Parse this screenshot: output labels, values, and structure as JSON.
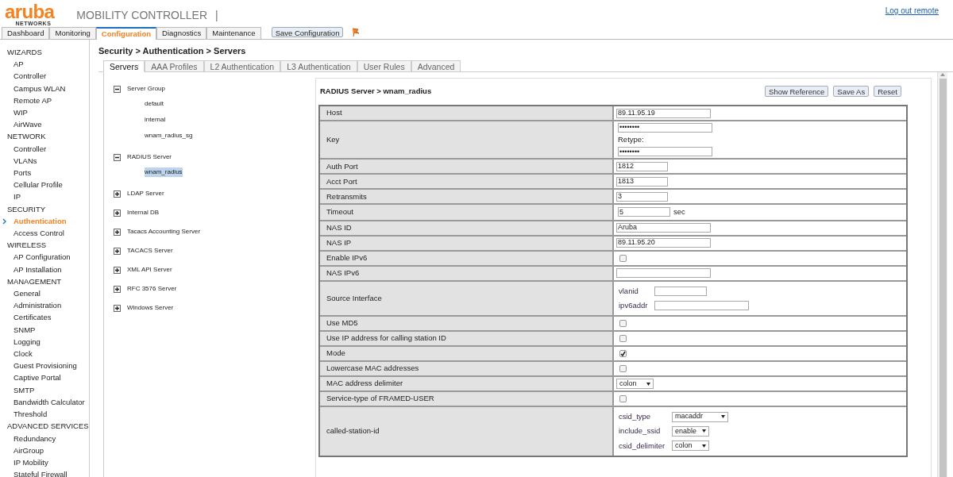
{
  "header": {
    "logo": "aruba",
    "logo_sub": "NETWORKS",
    "product": "MOBILITY CONTROLLER",
    "separator": "|",
    "logout": "Log out remote"
  },
  "nav": {
    "tabs": [
      {
        "label": "Dashboard",
        "selected": false
      },
      {
        "label": "Monitoring",
        "selected": false
      },
      {
        "label": "Configuration",
        "selected": true
      },
      {
        "label": "Diagnostics",
        "selected": false
      },
      {
        "label": "Maintenance",
        "selected": false
      }
    ],
    "save_button": "Save Configuration"
  },
  "sidebar": {
    "sections": [
      {
        "title": "WIZARDS",
        "items": [
          {
            "label": "AP",
            "selected": false
          },
          {
            "label": "Controller",
            "selected": false
          },
          {
            "label": "Campus WLAN",
            "selected": false
          },
          {
            "label": "Remote AP",
            "selected": false
          },
          {
            "label": "WIP",
            "selected": false
          },
          {
            "label": "AirWave",
            "selected": false
          }
        ]
      },
      {
        "title": "NETWORK",
        "items": [
          {
            "label": "Controller",
            "selected": false
          },
          {
            "label": "VLANs",
            "selected": false
          },
          {
            "label": "Ports",
            "selected": false
          },
          {
            "label": "Cellular Profile",
            "selected": false
          },
          {
            "label": "IP",
            "selected": false
          }
        ]
      },
      {
        "title": "SECURITY",
        "items": [
          {
            "label": "Authentication",
            "selected": true
          },
          {
            "label": "Access Control",
            "selected": false
          }
        ]
      },
      {
        "title": "WIRELESS",
        "items": [
          {
            "label": "AP Configuration",
            "selected": false
          },
          {
            "label": "AP Installation",
            "selected": false
          }
        ]
      },
      {
        "title": "MANAGEMENT",
        "items": [
          {
            "label": "General",
            "selected": false
          },
          {
            "label": "Administration",
            "selected": false
          },
          {
            "label": "Certificates",
            "selected": false
          },
          {
            "label": "SNMP",
            "selected": false
          },
          {
            "label": "Logging",
            "selected": false
          },
          {
            "label": "Clock",
            "selected": false
          },
          {
            "label": "Guest Provisioning",
            "selected": false
          },
          {
            "label": "Captive Portal",
            "selected": false
          },
          {
            "label": "SMTP",
            "selected": false
          },
          {
            "label": "Bandwidth Calculator",
            "selected": false
          },
          {
            "label": "Threshold",
            "selected": false
          }
        ]
      },
      {
        "title": "ADVANCED SERVICES",
        "items": [
          {
            "label": "Redundancy",
            "selected": false
          },
          {
            "label": "AirGroup",
            "selected": false
          },
          {
            "label": "IP Mobility",
            "selected": false
          },
          {
            "label": "Stateful Firewall",
            "selected": false
          }
        ]
      }
    ]
  },
  "breadcrumb": "Security > Authentication > Servers",
  "tabs": [
    {
      "label": "Servers",
      "selected": true
    },
    {
      "label": "AAA Profiles",
      "selected": false
    },
    {
      "label": "L2 Authentication",
      "selected": false
    },
    {
      "label": "L3 Authentication",
      "selected": false
    },
    {
      "label": "User Rules",
      "selected": false
    },
    {
      "label": "Advanced",
      "selected": false
    }
  ],
  "tree": [
    {
      "label": "Server Group",
      "expanded": true,
      "children": [
        {
          "label": "default",
          "selected": false
        },
        {
          "label": "internal",
          "selected": false
        },
        {
          "label": "wnam_radius_sg",
          "selected": false
        }
      ]
    },
    {
      "label": "RADIUS Server",
      "expanded": true,
      "children": [
        {
          "label": "wnam_radius",
          "selected": true
        }
      ]
    },
    {
      "label": "LDAP Server",
      "expanded": false
    },
    {
      "label": "Internal DB",
      "expanded": false
    },
    {
      "label": "Tacacs Accounting Server",
      "expanded": false
    },
    {
      "label": "TACACS Server",
      "expanded": false
    },
    {
      "label": "XML API Server",
      "expanded": false
    },
    {
      "label": "RFC 3576 Server",
      "expanded": false
    },
    {
      "label": "Windows Server",
      "expanded": false
    }
  ],
  "form": {
    "title": "RADIUS Server > wnam_radius",
    "buttons": [
      "Show Reference",
      "Save As",
      "Reset"
    ],
    "rows": [
      {
        "label": "Host",
        "kind": "text",
        "value": "89.11.95.19"
      },
      {
        "label": "Key",
        "kind": "password",
        "value": "••••••••",
        "retype_label": "Retype:",
        "retype_value": "••••••••"
      },
      {
        "label": "Auth Port",
        "kind": "number",
        "value": "1812"
      },
      {
        "label": "Acct Port",
        "kind": "number",
        "value": "1813"
      },
      {
        "label": "Retransmits",
        "kind": "number",
        "value": "3"
      },
      {
        "label": "Timeout",
        "kind": "number",
        "value": "5",
        "suffix": "sec"
      },
      {
        "label": "NAS ID",
        "kind": "text",
        "value": "Aruba"
      },
      {
        "label": "NAS IP",
        "kind": "text",
        "value": "89.11.95.20"
      },
      {
        "label": "Enable IPv6",
        "kind": "checkbox",
        "checked": false
      },
      {
        "label": "NAS IPv6",
        "kind": "text"
      },
      {
        "label": "Source Interface",
        "kind": "fields",
        "fields": [
          {
            "label": "vlanid",
            "kind": "number"
          },
          {
            "label": "ipv6addr",
            "kind": "text"
          }
        ]
      },
      {
        "label": "Use MD5",
        "kind": "checkbox",
        "checked": false
      },
      {
        "label": "Use IP address for calling station ID",
        "kind": "checkbox",
        "checked": false
      },
      {
        "label": "Mode",
        "kind": "checkbox",
        "checked": true
      },
      {
        "label": "Lowercase MAC addresses",
        "kind": "checkbox",
        "checked": false
      },
      {
        "label": "MAC address delimiter",
        "kind": "select",
        "value": "colon"
      },
      {
        "label": "Service-type of FRAMED-USER",
        "kind": "checkbox",
        "checked": false
      },
      {
        "label": "called-station-id",
        "kind": "selects",
        "fields": [
          {
            "label": "csid_type",
            "value": "macaddr"
          },
          {
            "label": "include_ssid",
            "value": "enable"
          },
          {
            "label": "csid_delimiter",
            "value": "colon"
          }
        ]
      }
    ]
  }
}
